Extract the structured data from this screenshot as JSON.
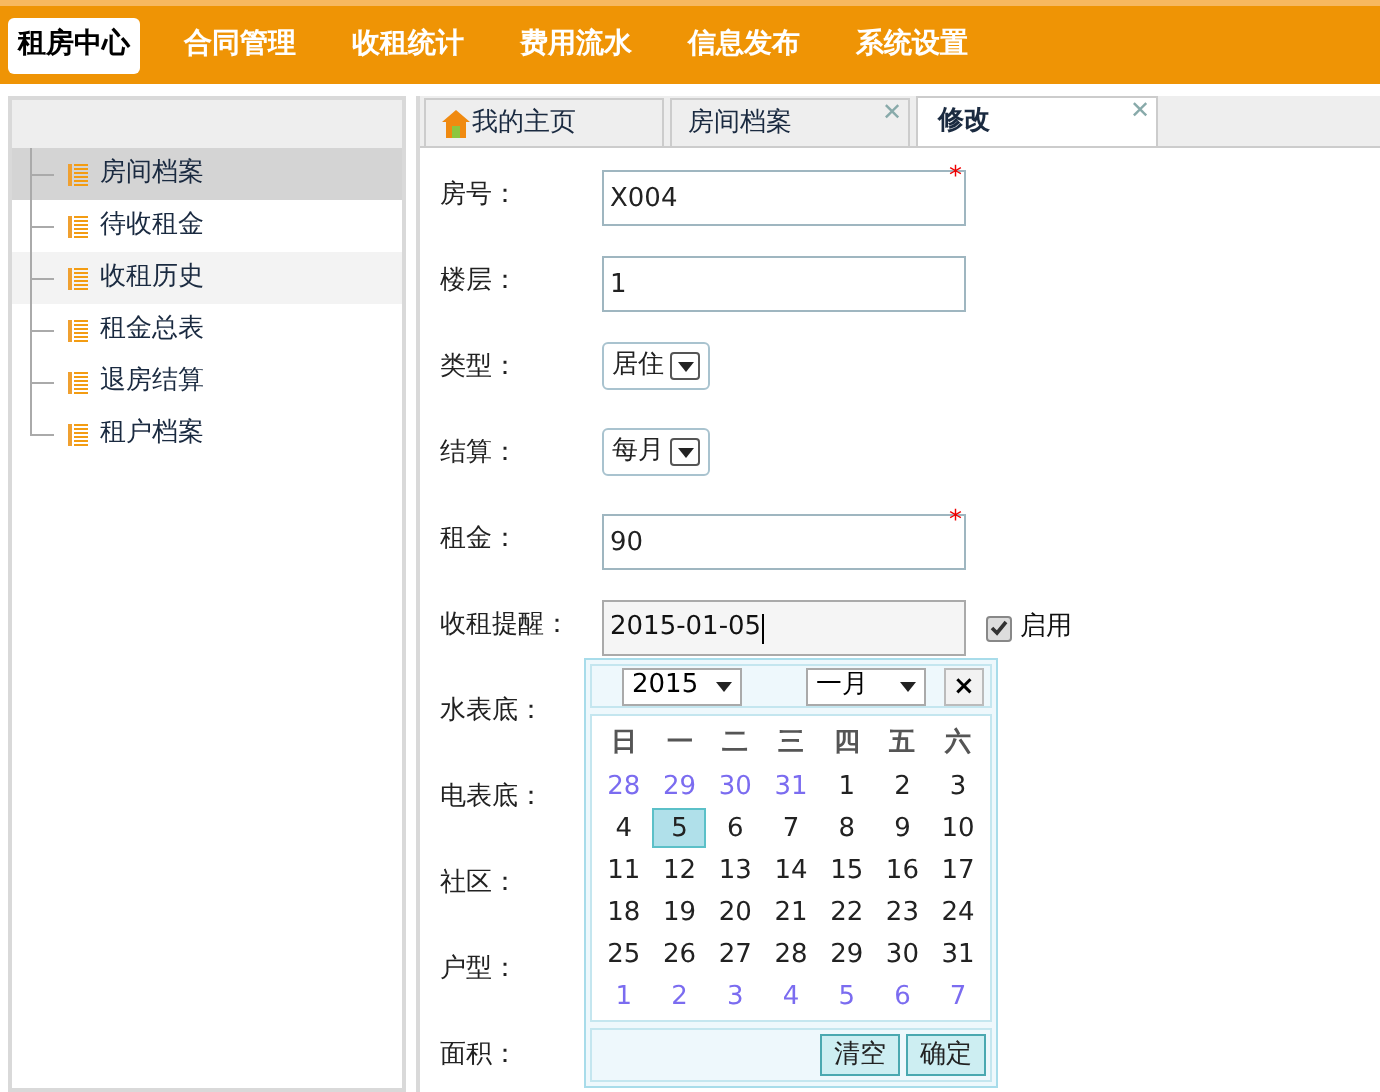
{
  "nav": [
    {
      "label": "租房中心",
      "selected": true
    },
    {
      "label": "合同管理",
      "selected": false
    },
    {
      "label": "收租统计",
      "selected": false
    },
    {
      "label": "费用流水",
      "selected": false
    },
    {
      "label": "信息发布",
      "selected": false
    },
    {
      "label": "系统设置",
      "selected": false
    }
  ],
  "sidebar": {
    "items": [
      {
        "label": "房间档案",
        "selected": true,
        "hovered": false
      },
      {
        "label": "待收租金",
        "selected": false,
        "hovered": false
      },
      {
        "label": "收租历史",
        "selected": false,
        "hovered": true
      },
      {
        "label": "租金总表",
        "selected": false,
        "hovered": false
      },
      {
        "label": "退房结算",
        "selected": false,
        "hovered": false
      },
      {
        "label": "租户档案",
        "selected": false,
        "hovered": false
      }
    ]
  },
  "tabs": [
    {
      "label": "我的主页",
      "selected": false,
      "home": true
    },
    {
      "label": "房间档案",
      "selected": false,
      "home": false,
      "close": "✕"
    },
    {
      "label": "修改",
      "selected": true,
      "home": false,
      "close": "✕"
    }
  ],
  "form": [
    {
      "kind": "text",
      "label": "房号：",
      "value": "X004",
      "required_mark": "*"
    },
    {
      "kind": "text",
      "label": "楼层：",
      "value": "1"
    },
    {
      "kind": "select",
      "label": "类型：",
      "value": "居住"
    },
    {
      "kind": "select",
      "label": "结算：",
      "value": "每月"
    },
    {
      "kind": "text",
      "label": "租金：",
      "value": "90",
      "required_mark": "*"
    },
    {
      "kind": "date",
      "label": "收租提醒：",
      "value": "2015-01-05",
      "checkbox": {
        "label": "启用",
        "checked": true
      }
    },
    {
      "kind": "covered",
      "label": "水表底："
    },
    {
      "kind": "covered",
      "label": "电表底："
    },
    {
      "kind": "covered",
      "label": "社区："
    },
    {
      "kind": "covered",
      "label": "户型："
    },
    {
      "kind": "covered",
      "label": "面积："
    }
  ],
  "calendar": {
    "year": "2015",
    "month": "一月",
    "close": "×",
    "weekdays": [
      "日",
      "一",
      "二",
      "三",
      "四",
      "五",
      "六"
    ],
    "weeks": [
      [
        {
          "day": "28",
          "outside": true,
          "selected": false
        },
        {
          "day": "29",
          "outside": true,
          "selected": false
        },
        {
          "day": "30",
          "outside": true,
          "selected": false
        },
        {
          "day": "31",
          "outside": true,
          "selected": false
        },
        {
          "day": "1",
          "outside": false,
          "selected": false
        },
        {
          "day": "2",
          "outside": false,
          "selected": false
        },
        {
          "day": "3",
          "outside": false,
          "selected": false
        }
      ],
      [
        {
          "day": "4",
          "outside": false,
          "selected": false
        },
        {
          "day": "5",
          "outside": false,
          "selected": true
        },
        {
          "day": "6",
          "outside": false,
          "selected": false
        },
        {
          "day": "7",
          "outside": false,
          "selected": false
        },
        {
          "day": "8",
          "outside": false,
          "selected": false
        },
        {
          "day": "9",
          "outside": false,
          "selected": false
        },
        {
          "day": "10",
          "outside": false,
          "selected": false
        }
      ],
      [
        {
          "day": "11",
          "outside": false,
          "selected": false
        },
        {
          "day": "12",
          "outside": false,
          "selected": false
        },
        {
          "day": "13",
          "outside": false,
          "selected": false
        },
        {
          "day": "14",
          "outside": false,
          "selected": false
        },
        {
          "day": "15",
          "outside": false,
          "selected": false
        },
        {
          "day": "16",
          "outside": false,
          "selected": false
        },
        {
          "day": "17",
          "outside": false,
          "selected": false
        }
      ],
      [
        {
          "day": "18",
          "outside": false,
          "selected": false
        },
        {
          "day": "19",
          "outside": false,
          "selected": false
        },
        {
          "day": "20",
          "outside": false,
          "selected": false
        },
        {
          "day": "21",
          "outside": false,
          "selected": false
        },
        {
          "day": "22",
          "outside": false,
          "selected": false
        },
        {
          "day": "23",
          "outside": false,
          "selected": false
        },
        {
          "day": "24",
          "outside": false,
          "selected": false
        }
      ],
      [
        {
          "day": "25",
          "outside": false,
          "selected": false
        },
        {
          "day": "26",
          "outside": false,
          "selected": false
        },
        {
          "day": "27",
          "outside": false,
          "selected": false
        },
        {
          "day": "28",
          "outside": false,
          "selected": false
        },
        {
          "day": "29",
          "outside": false,
          "selected": false
        },
        {
          "day": "30",
          "outside": false,
          "selected": false
        },
        {
          "day": "31",
          "outside": false,
          "selected": false
        }
      ],
      [
        {
          "day": "1",
          "outside": true,
          "selected": false
        },
        {
          "day": "2",
          "outside": true,
          "selected": false
        },
        {
          "day": "3",
          "outside": true,
          "selected": false
        },
        {
          "day": "4",
          "outside": true,
          "selected": false
        },
        {
          "day": "5",
          "outside": true,
          "selected": false
        },
        {
          "day": "6",
          "outside": true,
          "selected": false
        },
        {
          "day": "7",
          "outside": true,
          "selected": false
        }
      ]
    ],
    "buttons": [
      "清空",
      "确定"
    ]
  }
}
